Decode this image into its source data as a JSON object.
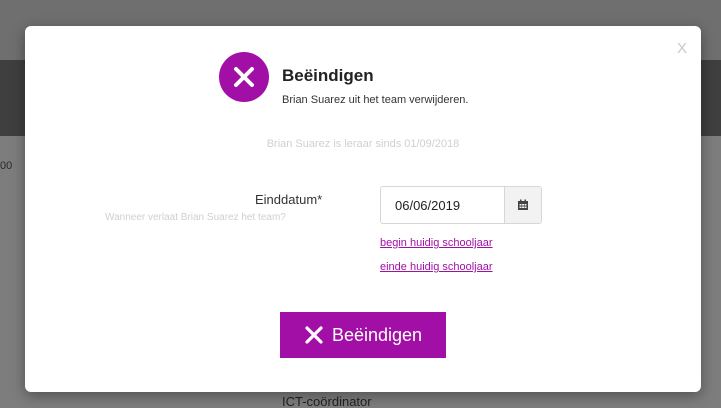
{
  "background": {
    "left_fragment": "00",
    "footer_text": "ICT-coördinator"
  },
  "modal": {
    "close_label": "X",
    "title": "Beëindigen",
    "subtitle": "Brian Suarez uit het team verwijderen.",
    "since_text": "Brian Suarez is leraar sinds 01/09/2018",
    "end_date": {
      "label": "Einddatum*",
      "hint": "Wanneer verlaat Brian Suarez het team?",
      "value": "06/06/2019",
      "calendar_icon": "calendar-icon"
    },
    "links": {
      "start_school_year": "begin huidig schooljaar",
      "end_school_year": "einde huidig schooljaar"
    },
    "confirm_button": {
      "label": "Beëindigen",
      "icon": "x-icon"
    }
  },
  "colors": {
    "accent": "#a20fa6",
    "overlay": "#7d7d7d"
  }
}
